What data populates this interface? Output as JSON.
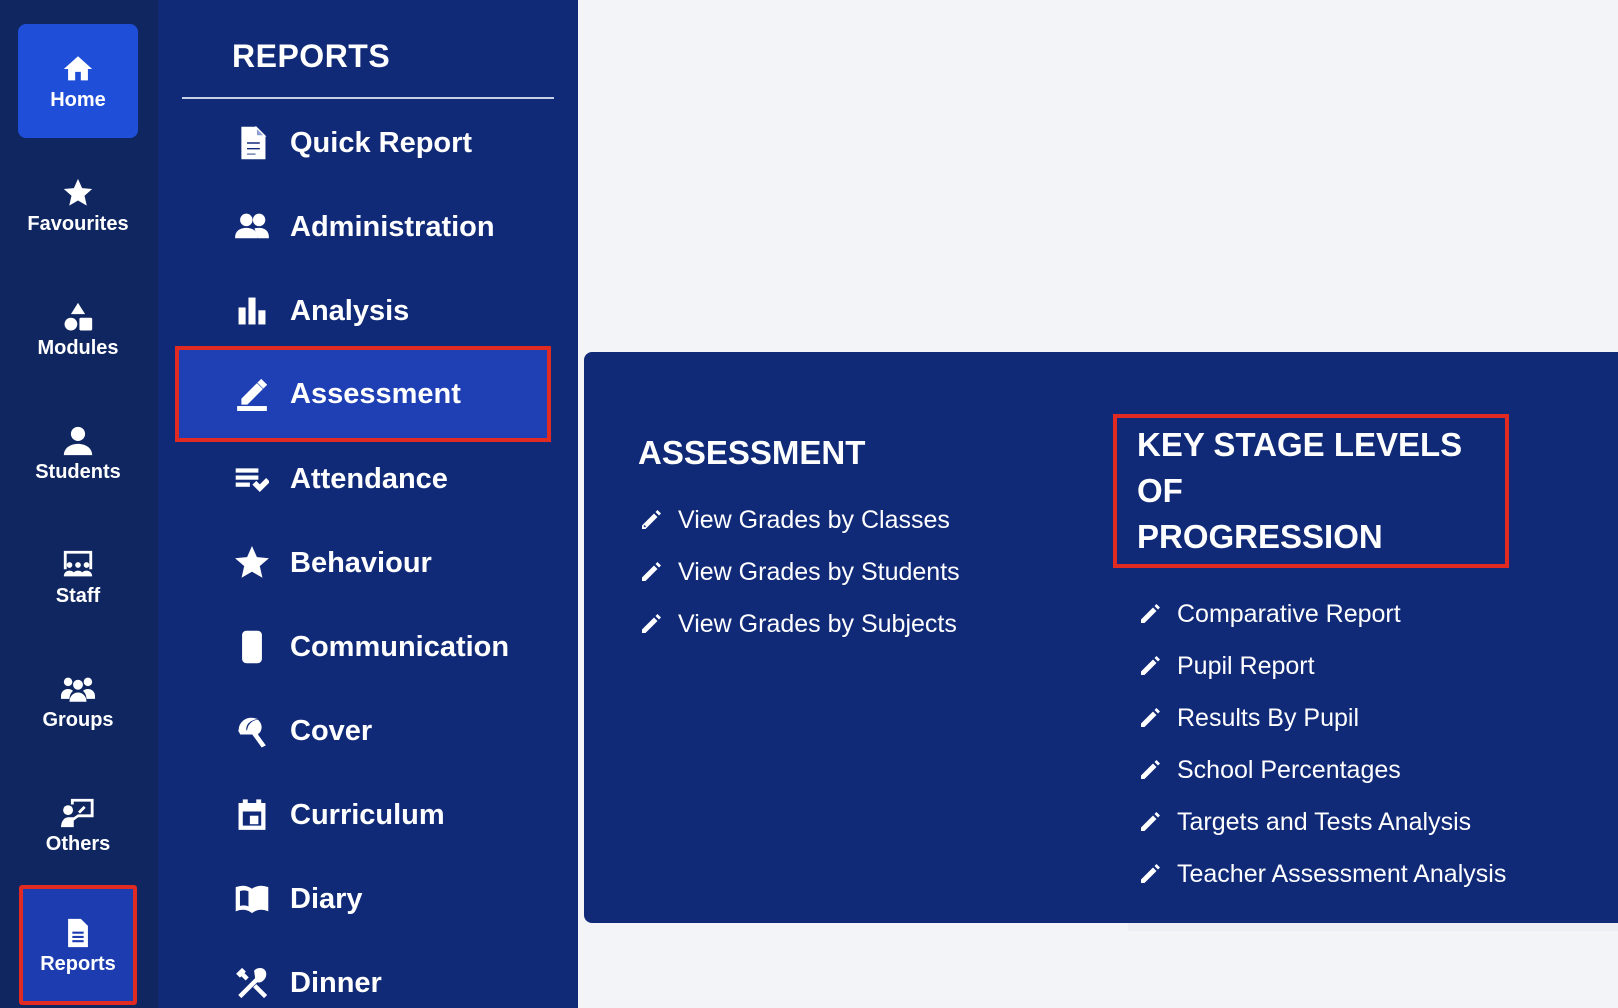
{
  "rail": {
    "items": [
      {
        "label": "Home",
        "icon": "home-icon"
      },
      {
        "label": "Favourites",
        "icon": "star-icon"
      },
      {
        "label": "Modules",
        "icon": "shapes-icon"
      },
      {
        "label": "Students",
        "icon": "user-icon"
      },
      {
        "label": "Staff",
        "icon": "presentation-icon"
      },
      {
        "label": "Groups",
        "icon": "users-icon"
      },
      {
        "label": "Others",
        "icon": "teacher-icon"
      },
      {
        "label": "Reports",
        "icon": "document-icon"
      }
    ]
  },
  "menu": {
    "title": "REPORTS",
    "items": [
      {
        "label": "Quick Report",
        "icon": "file-text-icon"
      },
      {
        "label": "Administration",
        "icon": "people-icon"
      },
      {
        "label": "Analysis",
        "icon": "bar-chart-icon"
      },
      {
        "label": "Assessment",
        "icon": "edit-pen-icon"
      },
      {
        "label": "Attendance",
        "icon": "checklist-icon"
      },
      {
        "label": "Behaviour",
        "icon": "star-outline-icon"
      },
      {
        "label": "Communication",
        "icon": "mobile-icon"
      },
      {
        "label": "Cover",
        "icon": "umbrella-icon"
      },
      {
        "label": "Curriculum",
        "icon": "calendar-icon"
      },
      {
        "label": "Diary",
        "icon": "book-open-icon"
      },
      {
        "label": "Dinner",
        "icon": "cutlery-icon"
      }
    ]
  },
  "flyout": {
    "assessment": {
      "title": "ASSESSMENT",
      "links": [
        "View Grades by Classes",
        "View Grades by Students",
        "View Grades by Subjects"
      ]
    },
    "key_stage": {
      "title_line1": "KEY STAGE LEVELS OF",
      "title_line2": "PROGRESSION",
      "links": [
        "Comparative Report",
        "Pupil Report",
        "Results By Pupil",
        "School Percentages",
        "Targets and Tests Analysis",
        "Teacher Assessment Analysis"
      ]
    }
  },
  "colors": {
    "rail_bg": "#0f2660",
    "menu_bg": "#112a78",
    "active_blue": "#1f4fd8",
    "highlight_red": "#e02a22",
    "page_bg": "#f3f4f8"
  }
}
